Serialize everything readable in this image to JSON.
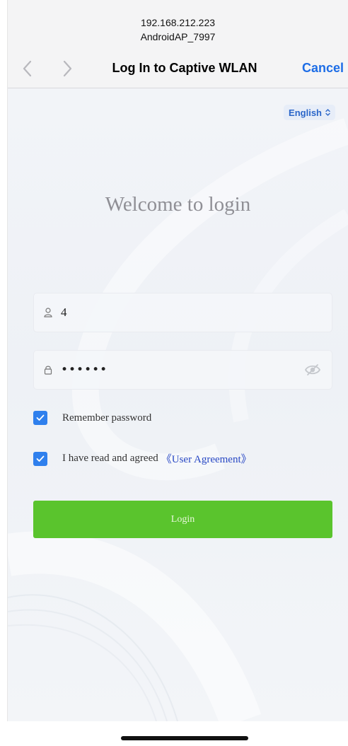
{
  "browser": {
    "host": "192.168.212.223",
    "ssid": "AndroidAP_7997",
    "title": "Log In to Captive WLAN",
    "cancel_label": "Cancel"
  },
  "page": {
    "language": "English",
    "welcome": "Welcome to login",
    "username_value": "4",
    "password_value": "••••••",
    "remember_label": "Remember password",
    "remember_checked": true,
    "agree_label": "I have read and agreed",
    "agreement_link": "《User Agreement》",
    "agree_checked": true,
    "login_label": "Login"
  },
  "colors": {
    "login_button": "#5ac42d",
    "checkbox": "#2f80ed",
    "cancel_text": "#1d6de6",
    "agreement_link": "#2848c4"
  },
  "icons": [
    "chevron-left-icon",
    "chevron-right-icon",
    "chevron-up-down-icon",
    "user-icon",
    "lock-icon",
    "eye-icon",
    "checkmark-icon"
  ]
}
